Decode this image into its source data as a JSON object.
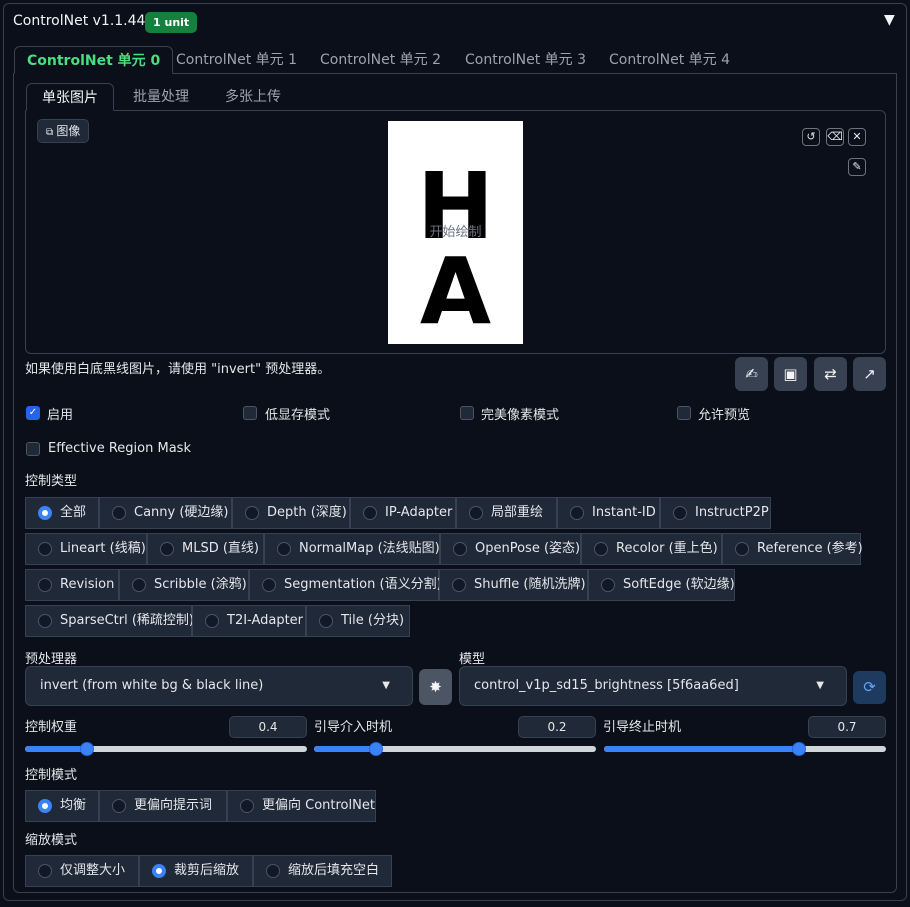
{
  "header": {
    "title": "ControlNet v1.1.449",
    "badge": "1 unit",
    "collapse_icon": "triangle-down-icon",
    "collapse_glyph": "▼"
  },
  "unit_tabs": [
    {
      "label": "ControlNet 单元 0",
      "active": true
    },
    {
      "label": "ControlNet 单元 1",
      "active": false
    },
    {
      "label": "ControlNet 单元 2",
      "active": false
    },
    {
      "label": "ControlNet 单元 3",
      "active": false
    },
    {
      "label": "ControlNet 单元 4",
      "active": false
    }
  ],
  "input_tabs": [
    {
      "label": "单张图片",
      "active": true
    },
    {
      "label": "批量处理",
      "active": false
    },
    {
      "label": "多张上传",
      "active": false
    }
  ],
  "canvas": {
    "image_label": "图像",
    "picture_text": [
      "H",
      "A"
    ],
    "draw_hint": "开始绘制",
    "icons": {
      "undo": "undo-icon",
      "erase": "eraser-icon",
      "close": "close-icon",
      "brush": "brush-icon"
    }
  },
  "hint_text": "如果使用白底黑线图片，请使用 \"invert\" 预处理器。",
  "tool_buttons": [
    "edit-image-icon",
    "camera-icon",
    "swap-icon",
    "send-dimensions-icon"
  ],
  "checkboxes": [
    {
      "label": "启用",
      "checked": true
    },
    {
      "label": "低显存模式",
      "checked": false
    },
    {
      "label": "完美像素模式",
      "checked": false
    },
    {
      "label": "允许预览",
      "checked": false
    },
    {
      "label": "Effective Region Mask",
      "checked": false
    }
  ],
  "control_type": {
    "label": "控制类型",
    "options": [
      "全部",
      "Canny (硬边缘)",
      "Depth (深度)",
      "IP-Adapter",
      "局部重绘",
      "Instant-ID",
      "InstructP2P",
      "Lineart (线稿)",
      "MLSD (直线)",
      "NormalMap (法线贴图)",
      "OpenPose (姿态)",
      "Recolor (重上色)",
      "Reference (参考)",
      "Revision",
      "Scribble (涂鸦)",
      "Segmentation (语义分割)",
      "Shuffle (随机洗牌)",
      "SoftEdge (软边缘)",
      "SparseCtrl (稀疏控制)",
      "T2I-Adapter",
      "Tile (分块)"
    ],
    "selected": "全部"
  },
  "preprocessor": {
    "label": "预处理器",
    "value": "invert (from white bg & black line)",
    "run_icon": "explosion-icon"
  },
  "model": {
    "label": "模型",
    "value": "control_v1p_sd15_brightness [5f6aa6ed]",
    "refresh_icon": "refresh-icon"
  },
  "sliders": [
    {
      "label": "控制权重",
      "value": "0.4",
      "fraction": 0.2
    },
    {
      "label": "引导介入时机",
      "value": "0.2",
      "fraction": 0.2
    },
    {
      "label": "引导终止时机",
      "value": "0.7",
      "fraction": 0.7
    }
  ],
  "control_mode": {
    "label": "控制模式",
    "options": [
      "均衡",
      "更偏向提示词",
      "更偏向 ControlNet"
    ],
    "selected": "均衡"
  },
  "resize_mode": {
    "label": "缩放模式",
    "options": [
      "仅调整大小",
      "裁剪后缩放",
      "缩放后填充空白"
    ],
    "selected": "裁剪后缩放"
  },
  "colors": {
    "accent": "#3b82f6",
    "active_tab": "#4ade80",
    "badge": "#15803d",
    "panel_bg": "#1f2937",
    "page_bg": "#0b0f19"
  }
}
